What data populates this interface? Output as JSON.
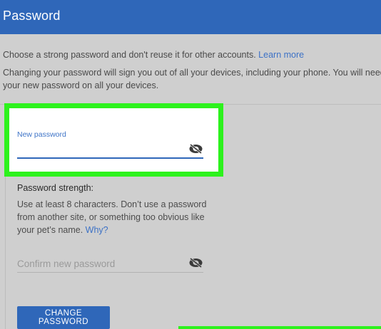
{
  "header": {
    "title": "Password"
  },
  "info": {
    "line1": "Choose a strong password and don't reuse it for other accounts.",
    "learn_more": "Learn more",
    "line2": "Changing your password will sign you out of all your devices, including your phone. You will need to",
    "line3": "your new password on all your devices."
  },
  "new_password": {
    "label": "New password",
    "value": ""
  },
  "strength": {
    "title": "Password strength:",
    "text": "Use at least 8 characters. Don’t use a password from another site, or something too obvious like your pet’s name.",
    "why": "Why?"
  },
  "confirm": {
    "placeholder": "Confirm new password"
  },
  "button": {
    "label": "CHANGE PASSWORD"
  },
  "colors": {
    "header": "#2f67b9",
    "link": "#3d72c6",
    "highlight": "#2df21d"
  },
  "icons": {
    "toggle_visibility": "eye-off-icon"
  }
}
